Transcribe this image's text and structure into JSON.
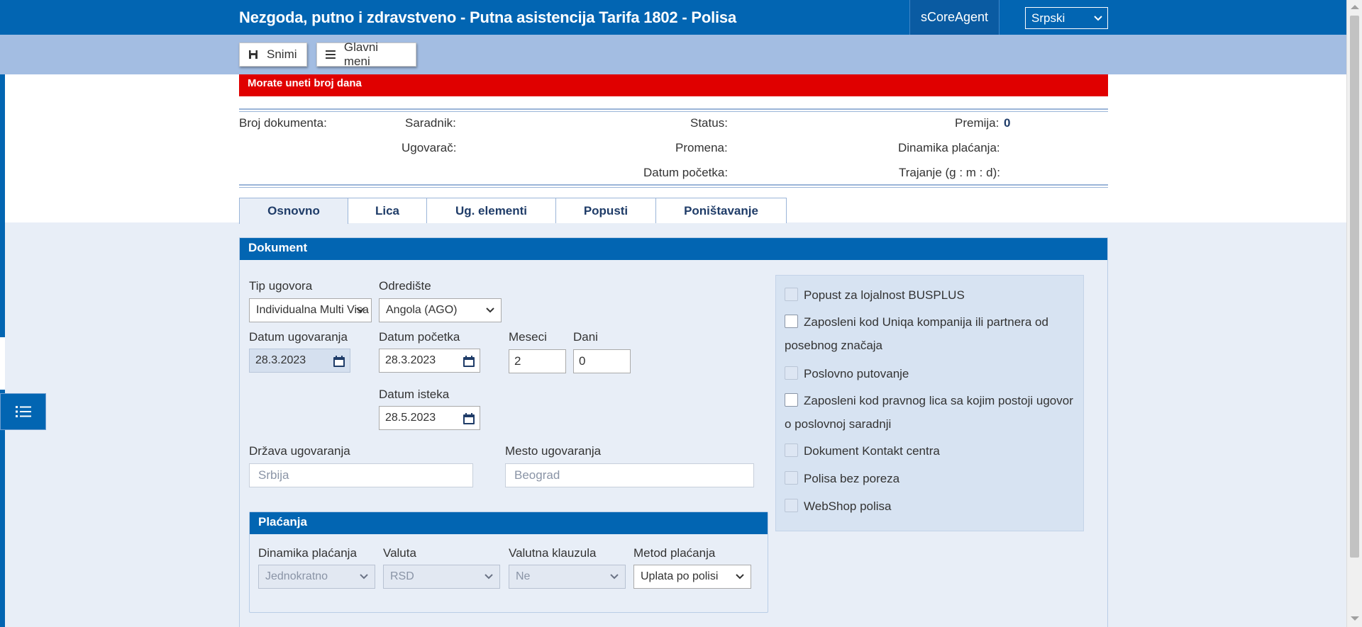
{
  "header": {
    "title": "Nezgoda, putno i zdravstveno - Putna asistencija Tarifa 1802 - Polisa",
    "agent": "sCoreAgent",
    "language": "Srpski"
  },
  "toolbar": {
    "save_label": "Snimi",
    "menu_label": "Glavni meni"
  },
  "error_message": "Morate uneti broj dana",
  "summary": {
    "broj_dokumenta": "Broj dokumenta:",
    "saradnik": "Saradnik:",
    "ugovarac": "Ugovarač:",
    "status": "Status:",
    "promena": "Promena:",
    "datum_pocetka": "Datum početka:",
    "premija": "Premija:",
    "premija_value": "0",
    "dinamika_placanja": "Dinamika plaćanja:",
    "trajanje": "Trajanje (g : m : d):"
  },
  "tabs": [
    {
      "label": "Osnovno",
      "active": true
    },
    {
      "label": "Lica"
    },
    {
      "label": "Ug. elementi"
    },
    {
      "label": "Popusti"
    },
    {
      "label": "Poništavanje"
    }
  ],
  "dokument": {
    "heading": "Dokument",
    "tip_ugovora_label": "Tip ugovora",
    "tip_ugovora_value": "Individualna Multi Visa",
    "odrediste_label": "Odredište",
    "odrediste_value": "Angola (AGO)",
    "datum_ugovaranja_label": "Datum ugovaranja",
    "datum_ugovaranja_value": "28.3.2023",
    "datum_pocetka_label": "Datum početka",
    "datum_pocetka_value": "28.3.2023",
    "meseci_label": "Meseci",
    "meseci_value": "2",
    "dani_label": "Dani",
    "dani_value": "0",
    "datum_isteka_label": "Datum isteka",
    "datum_isteka_value": "28.5.2023",
    "drzava_label": "Država ugovaranja",
    "drzava_value": "Srbija",
    "mesto_label": "Mesto ugovaranja",
    "mesto_value": "Beograd"
  },
  "checkboxes": [
    {
      "label": "Popust za lojalnost BUSPLUS",
      "enabled": false
    },
    {
      "label": "Zaposleni kod Uniqa kompanija ili partnera od",
      "label2": "posebnog značaja",
      "enabled": true
    },
    {
      "label": "Poslovno putovanje",
      "enabled": false
    },
    {
      "label": "Zaposleni kod pravnog lica sa kojim postoji ugovor",
      "label2": "o poslovnoj saradnji",
      "enabled": true
    },
    {
      "label": "Dokument Kontakt centra",
      "enabled": false
    },
    {
      "label": "Polisa bez poreza",
      "enabled": false
    },
    {
      "label": "WebShop polisa",
      "enabled": false
    }
  ],
  "placanja": {
    "heading": "Plaćanja",
    "dinamika_label": "Dinamika plaćanja",
    "dinamika_value": "Jednokratno",
    "valuta_label": "Valuta",
    "valuta_value": "RSD",
    "klauzula_label": "Valutna klauzula",
    "klauzula_value": "Ne",
    "metod_label": "Metod plaćanja",
    "metod_value": "Uplata po polisi"
  },
  "colors": {
    "primary": "#0265b2",
    "toolbar": "#a3bde2",
    "error": "#e00000",
    "background": "#e8eef7"
  }
}
